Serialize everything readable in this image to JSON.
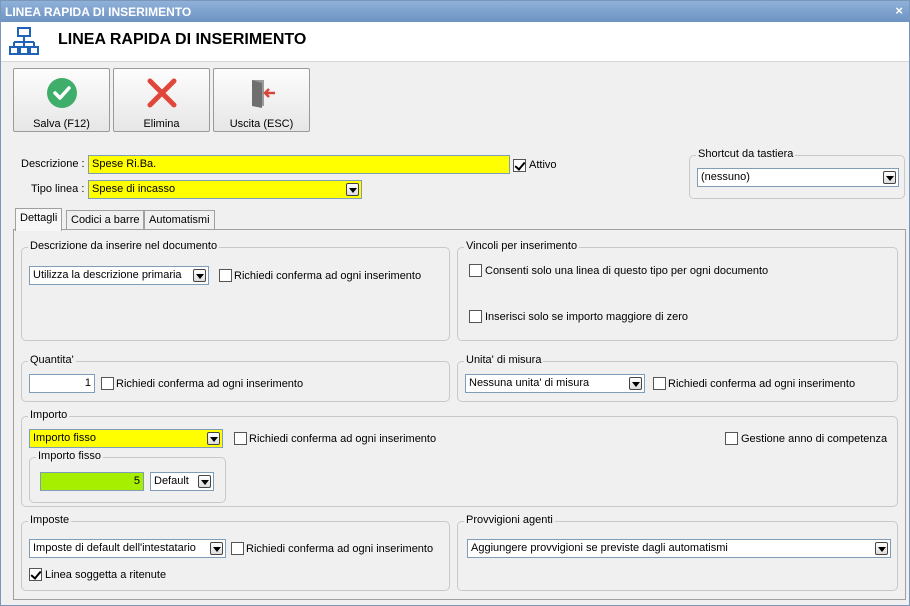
{
  "window": {
    "title": "LINEA RAPIDA DI INSERIMENTO",
    "close_glyph": "×"
  },
  "header": {
    "title": "LINEA RAPIDA DI INSERIMENTO",
    "icon": "network-icon"
  },
  "toolbar": {
    "save_label": "Salva (F12)",
    "delete_label": "Elimina",
    "exit_label": "Uscita (ESC)",
    "colors": {
      "save": "#3fae6b",
      "delete": "#e0473a",
      "exit": "#d9453a"
    }
  },
  "form": {
    "description_label": "Descrizione :",
    "description_value": "Spese Ri.Ba.",
    "active_label": "Attivo",
    "active_checked": true,
    "type_label": "Tipo linea :",
    "type_value": "Spese di incasso"
  },
  "shortcut": {
    "label": "Shortcut da tastiera",
    "value": "(nessuno)"
  },
  "tabs": [
    "Dettagli",
    "Codici a barre",
    "Automatismi"
  ],
  "details": {
    "desc_group": {
      "title": "Descrizione da inserire nel documento",
      "select_value": "Utilizza la descrizione primaria",
      "confirm_label": "Richiedi conferma ad ogni inserimento"
    },
    "constraints": {
      "title": "Vincoli per inserimento",
      "one_line_label": "Consenti solo una linea di questo tipo per ogni documento",
      "positive_label": "Inserisci solo se importo maggiore di zero"
    },
    "quantity": {
      "title": "Quantita'",
      "value": "1",
      "confirm_label": "Richiedi conferma ad ogni inserimento"
    },
    "unit": {
      "title": "Unita' di misura",
      "select_value": "Nessuna unita' di misura",
      "confirm_label": "Richiedi conferma ad ogni inserimento"
    },
    "amount": {
      "title": "Importo",
      "select_value": "Importo fisso",
      "confirm_label": "Richiedi conferma ad ogni inserimento",
      "year_label": "Gestione anno di competenza",
      "fixed_title": "Importo fisso",
      "fixed_value": "5",
      "fixed_mode": "Default"
    },
    "taxes": {
      "title": "Imposte",
      "select_value": "Imposte di default dell'intestatario",
      "confirm_label": "Richiedi conferma ad ogni inserimento",
      "withholding_label": "Linea soggetta a ritenute",
      "withholding_checked": true
    },
    "commissions": {
      "title": "Provvigioni agenti",
      "select_value": "Aggiungere provvigioni se previste dagli automatismi"
    }
  }
}
